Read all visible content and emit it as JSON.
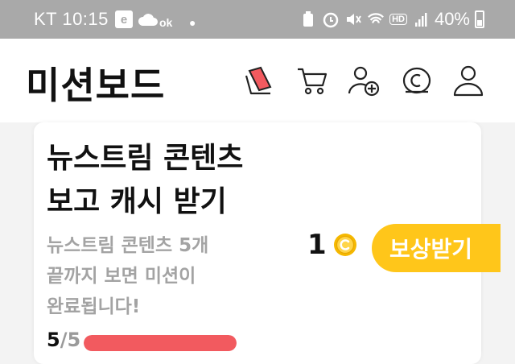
{
  "status_bar": {
    "carrier_time": "KT 10:15",
    "ok_label": "ok",
    "network_badge": "HD",
    "battery_text": "40%"
  },
  "app": {
    "title": "미션보드",
    "icons": [
      "missions-card-icon",
      "cart-icon",
      "add-friend-icon",
      "coin-icon",
      "profile-icon"
    ]
  },
  "mission": {
    "title_line1": "뉴스트림 콘텐츠",
    "title_line2": "보고 캐시 받기",
    "desc_line1": "뉴스트림 콘텐츠 5개",
    "desc_line2": "끝까지 보면 미션이",
    "desc_line3": "완료됩니다!",
    "reward": "1",
    "claim_label": "보상받기",
    "progress_current": "5",
    "progress_total": "/5",
    "progress_fraction": 1.0
  },
  "colors": {
    "status_bar_bg": "#a9a9a9",
    "accent_yellow": "#ffc61a",
    "progress_red": "#f25a5f",
    "coin_gold": "#f5b800"
  }
}
